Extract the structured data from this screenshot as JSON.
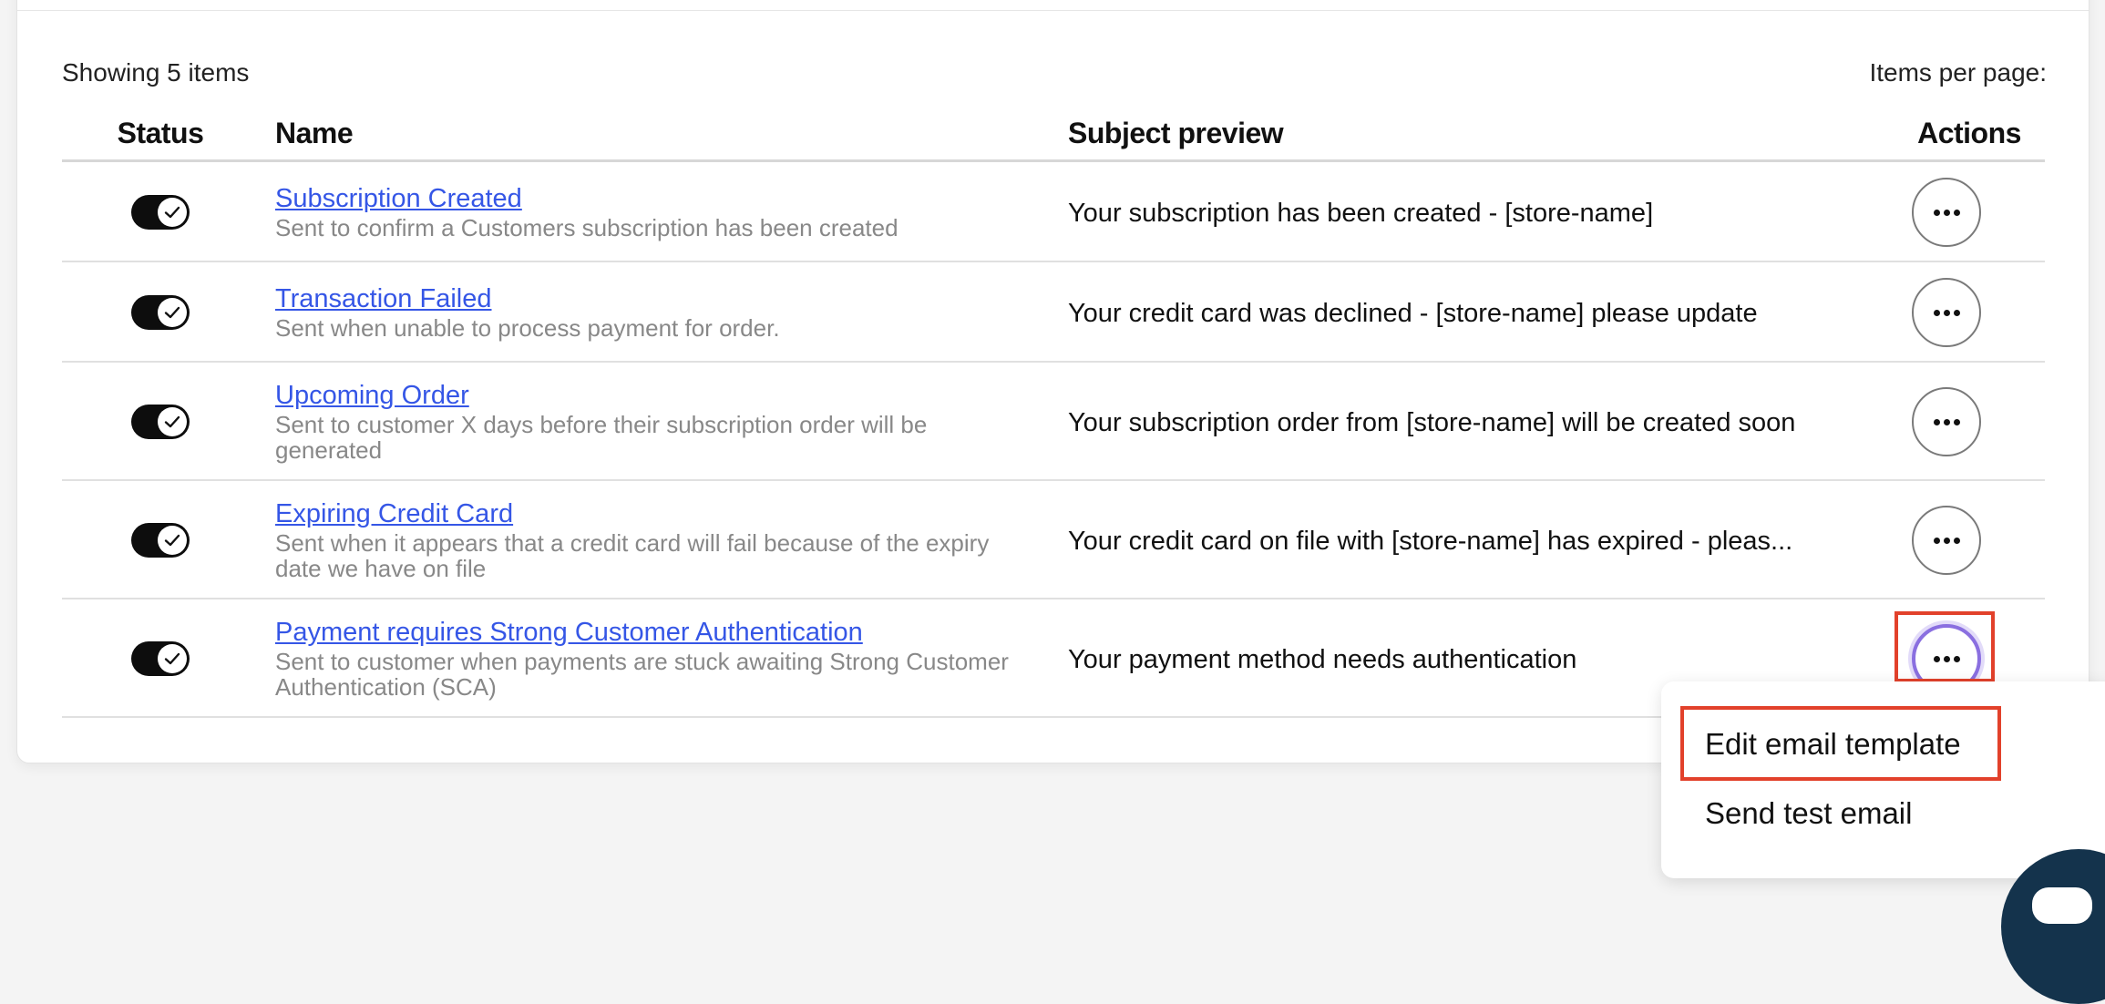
{
  "summary": {
    "showing": "Showing 5 items",
    "per_page_label": "Items per page:"
  },
  "columns": {
    "status": "Status",
    "name": "Name",
    "subject": "Subject preview",
    "actions": "Actions"
  },
  "rows": [
    {
      "name": "Subscription Created",
      "description": "Sent to confirm a Customers subscription has been created",
      "subject": "Your subscription has been created - [store-name]",
      "enabled": true
    },
    {
      "name": "Transaction Failed",
      "description": "Sent when unable to process payment for order.",
      "subject": "Your credit card was declined - [store-name] please update",
      "enabled": true
    },
    {
      "name": "Upcoming Order",
      "description": "Sent to customer X days before their subscription order will be generated",
      "subject": "Your subscription order from [store-name] will be created soon",
      "enabled": true
    },
    {
      "name": "Expiring Credit Card",
      "description": "Sent when it appears that a credit card will fail because of the expiry date we have on file",
      "subject": "Your credit card on file with [store-name] has expired - pleas...",
      "enabled": true
    },
    {
      "name": "Payment requires Strong Customer Authentication",
      "description": "Sent to customer when payments are stuck awaiting Strong Customer Authentication (SCA)",
      "subject": "Your payment method needs authentication",
      "enabled": true
    }
  ],
  "menu": {
    "edit": "Edit email template",
    "send_test": "Send test email"
  },
  "icons": {
    "toggle": "check-icon",
    "actions": "more-horizontal-icon",
    "chat": "chat-bubble-icon"
  },
  "colors": {
    "link": "#3556e6",
    "highlight": "#e2412b",
    "focus_ring": "#8a6fe0",
    "fab": "#14334c"
  }
}
